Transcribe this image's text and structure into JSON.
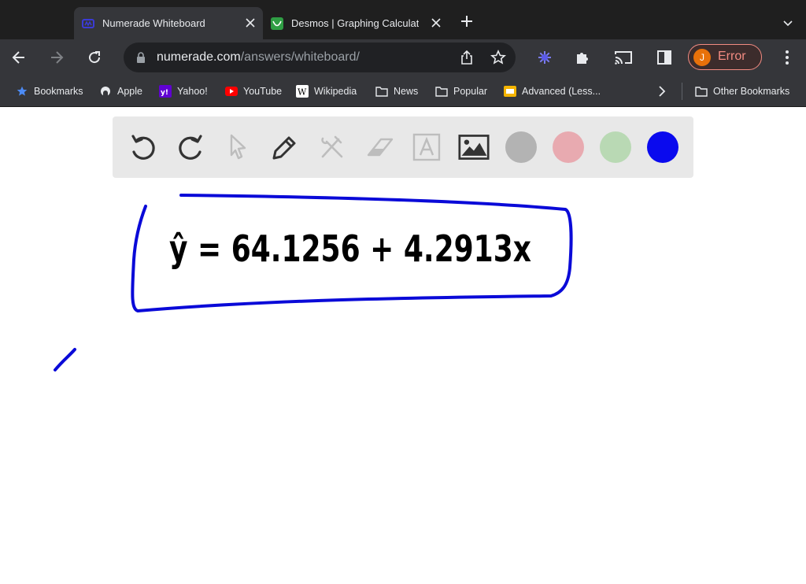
{
  "tabs": [
    {
      "title": "Numerade Whiteboard",
      "active": true
    },
    {
      "title": "Desmos | Graphing Calculator",
      "active": false
    }
  ],
  "address": {
    "host": "numerade.com",
    "path": "/answers/whiteboard/"
  },
  "profile": {
    "initial": "J",
    "label": "Error"
  },
  "bookmarks": [
    {
      "label": "Bookmarks",
      "icon": "star-icon"
    },
    {
      "label": "Apple",
      "icon": "apple-icon"
    },
    {
      "label": "Yahoo!",
      "icon": "yahoo-icon"
    },
    {
      "label": "YouTube",
      "icon": "youtube-icon"
    },
    {
      "label": "Wikipedia",
      "icon": "wikipedia-icon"
    },
    {
      "label": "News",
      "icon": "folder-icon"
    },
    {
      "label": "Popular",
      "icon": "folder-icon"
    },
    {
      "label": "Advanced (Less...",
      "icon": "yellow-page-icon"
    },
    {
      "label": "Other Bookmarks",
      "icon": "folder-icon"
    }
  ],
  "whiteboard": {
    "tools": [
      "undo-icon",
      "redo-icon",
      "pointer-icon",
      "pen-icon",
      "tools-icon",
      "eraser-icon",
      "text-icon",
      "image-icon"
    ],
    "colors": [
      "#b3b3b3",
      "#e8aab0",
      "#b9d9b4",
      "#0a0aee"
    ],
    "ink_color": "#0a0ad8",
    "equation": "ŷ = 64.1256 + 4.2913x"
  }
}
